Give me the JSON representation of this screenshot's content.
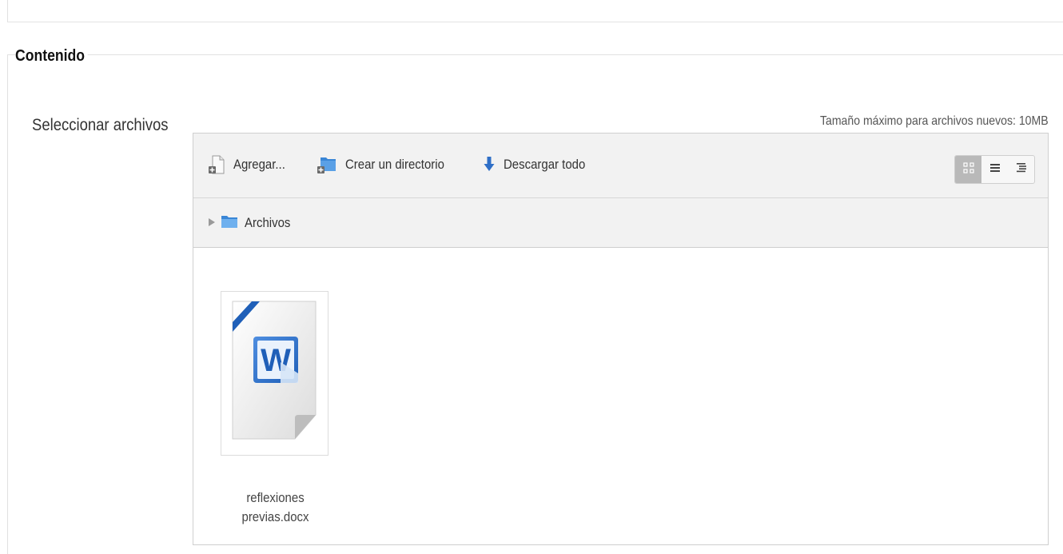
{
  "section": {
    "legend": "Contenido",
    "field_label": "Seleccionar archivos",
    "max_size_text": "Tamaño máximo para archivos nuevos: 10MB"
  },
  "toolbar": {
    "add_label": "Agregar...",
    "create_dir_label": "Crear un directorio",
    "download_all_label": "Descargar todo",
    "views": [
      {
        "name": "icons",
        "icon": "grid-icon",
        "active": true
      },
      {
        "name": "details",
        "icon": "list-icon",
        "active": false
      },
      {
        "name": "tree",
        "icon": "tree-list-icon",
        "active": false
      }
    ]
  },
  "path": {
    "folder": "Archivos"
  },
  "files": [
    {
      "name_line1": "reflexiones",
      "name_line2": "previas.docx",
      "icon": "word-document-icon"
    }
  ],
  "colors": {
    "download_arrow": "#2f6fc7",
    "folder_blue": "#3a86d6",
    "word_blue": "#1f5fb8",
    "active_view_bg": "#b9b9b9"
  }
}
